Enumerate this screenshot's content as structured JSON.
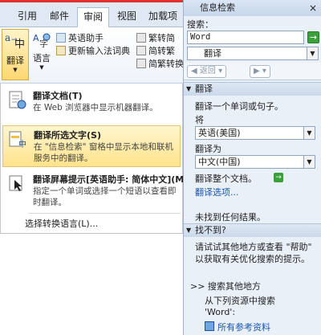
{
  "ribbon": {
    "tabs": [
      "引用",
      "邮件",
      "审阅",
      "视图",
      "加载项"
    ],
    "active_tab": "审阅",
    "translate_button": "翻译",
    "language_button": "语言",
    "english_assistant": "英语助手",
    "update_ime_dictionary": "更新输入法词典",
    "trad_to_simp": "繁转简",
    "simp_to_trad": "简转繁",
    "simp_trad_convert": "简繁转换"
  },
  "menu": {
    "items": [
      {
        "title": "翻译文档(T)",
        "desc": "在 Web 浏览器中显示机器翻译。"
      },
      {
        "title": "翻译所选文字(S)",
        "desc": "在 \"信息检索\" 窗格中显示本地和联机服务中的翻译。"
      },
      {
        "title": "翻译屏幕提示[英语助手: 简体中文](M)",
        "desc": "指定一个单词或选择一个短语以查看即时翻译。"
      }
    ],
    "footer": "选择转换语言(L)..."
  },
  "pane": {
    "title": "信息检索",
    "search_label": "搜索：",
    "search_value": "Word",
    "service": "翻译",
    "back": "返回",
    "translate_section": "翻译",
    "translate_hint": "翻译一个单词或句子。",
    "from_label": "将",
    "from_value": "英语(美国)",
    "to_label": "翻译为",
    "to_value": "中文(中国)",
    "translate_whole_doc": "翻译整个文档。",
    "translate_options": "翻译选项...",
    "no_results": "未找到任何结果。",
    "not_found_section": "找不到?",
    "help_text": "请试试其他地方或查看 \"帮助\" 以获取有关优化搜索的提示。",
    "search_other": ">> 搜索其他地方",
    "search_from": "从下列资源中搜索",
    "search_term": "'Word':",
    "all_references": "所有参考资料"
  },
  "colors": {
    "accent_highlight": "#ffe38b",
    "link": "#1a55b0",
    "go_button": "#3aa13a",
    "top_strip": "#e03030"
  }
}
